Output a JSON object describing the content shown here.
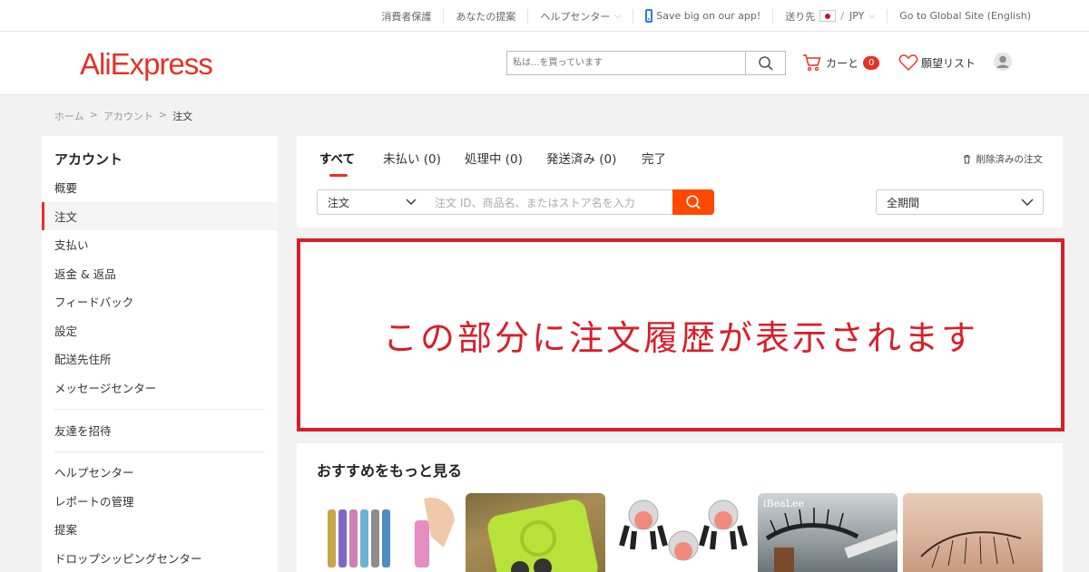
{
  "topbar": {
    "consumer_protection": "消費者保護",
    "suggestions": "あなたの提案",
    "help_center": "ヘルプセンター",
    "app_promo": "Save big on our app!",
    "ship_to_label": "送り先",
    "currency": "JPY",
    "global_site": "Go to Global Site (English)"
  },
  "header": {
    "logo": "AliExpress",
    "search_placeholder": "私は...を買っています",
    "cart_label": "カーと",
    "cart_count": "0",
    "wishlist_label": "願望リスト"
  },
  "breadcrumb": {
    "home": "ホーム",
    "account": "アカウント",
    "current": "注文",
    "separator": ">"
  },
  "sidebar": {
    "title": "アカウント",
    "items": [
      {
        "label": "概要"
      },
      {
        "label": "注文",
        "active": true
      },
      {
        "label": "支払い"
      },
      {
        "label": "返金 & 返品"
      },
      {
        "label": "フィードバック"
      },
      {
        "label": "設定"
      },
      {
        "label": "配送先住所"
      },
      {
        "label": "メッセージセンター"
      },
      {
        "label": "友達を招待"
      },
      {
        "label": "ヘルプセンター"
      },
      {
        "label": "レポートの管理"
      },
      {
        "label": "提案"
      },
      {
        "label": "ドロップシッピングセンター"
      }
    ]
  },
  "orders": {
    "tabs": [
      {
        "label": "すべて",
        "active": true
      },
      {
        "label": "未払い (0)"
      },
      {
        "label": "処理中 (0)"
      },
      {
        "label": "発送済み (0)"
      },
      {
        "label": "完了"
      }
    ],
    "deleted_orders": "削除済みの注文",
    "search_type": "注文",
    "search_placeholder": "注文 ID、商品名、またはストア名を入力",
    "period": "全期間"
  },
  "annotation": {
    "text": "この部分に注文履歴が表示されます",
    "color": "#d91e2a"
  },
  "recommendations": {
    "title": "おすすめをもっと見る",
    "product_badge": "iBeaLee"
  },
  "colors": {
    "brand": "#e43225",
    "search_button": "#fd4a00"
  }
}
